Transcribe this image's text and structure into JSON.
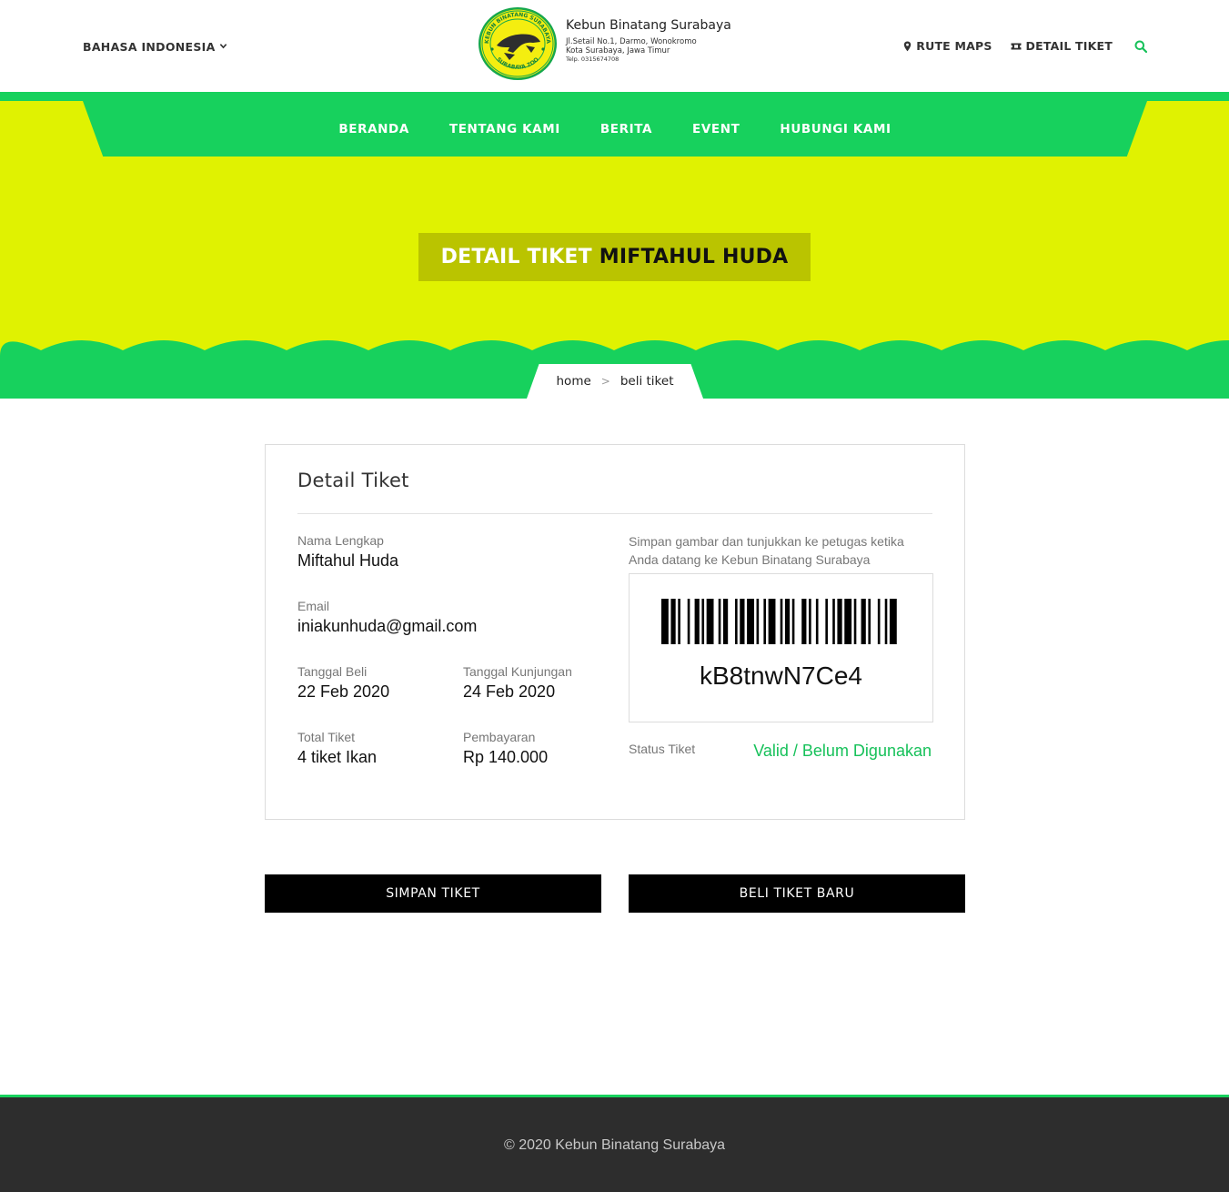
{
  "header": {
    "language": "BAHASA INDONESIA",
    "logo": {
      "ring_top_text": "KEBUN BINATANG SURABAYA",
      "ring_bottom_text": "SURABAYA ZOO",
      "title": "Kebun Binatang Surabaya",
      "address_line1": "Jl.Setail No.1, Darmo, Wonokromo",
      "address_line2": "Kota Surabaya, Jawa Timur",
      "phone": "Telp. 0315674708"
    },
    "links": [
      {
        "label": "RUTE MAPS",
        "icon": "map-pin-icon"
      },
      {
        "label": "DETAIL TIKET",
        "icon": "ticket-icon"
      }
    ],
    "search_icon": "search-icon"
  },
  "nav": {
    "items": [
      "BERANDA",
      "TENTANG KAMI",
      "BERITA",
      "EVENT",
      "HUBUNGI KAMI"
    ]
  },
  "hero": {
    "title_prefix": "DETAIL TIKET",
    "title_name": "MIFTAHUL HUDA",
    "breadcrumb": {
      "home": "home",
      "separator": ">",
      "current": "beli tiket"
    }
  },
  "ticket": {
    "card_title": "Detail Tiket",
    "name_label": "Nama Lengkap",
    "name_value": "Miftahul Huda",
    "email_label": "Email",
    "email_value": "iniakunhuda@gmail.com",
    "purchase_date_label": "Tanggal Beli",
    "purchase_date_value": "22 Feb 2020",
    "visit_date_label": "Tanggal Kunjungan",
    "visit_date_value": "24 Feb 2020",
    "total_label": "Total Tiket",
    "total_value": "4 tiket Ikan",
    "payment_label": "Pembayaran",
    "payment_value": "Rp 140.000",
    "note": "Simpan gambar dan tunjukkan ke petugas ketika Anda datang ke Kebun Binatang Surabaya",
    "code": "kB8tnwN7Ce4",
    "status_label": "Status Tiket",
    "status_value": "Valid / Belum Digunakan"
  },
  "buttons": {
    "save": "SIMPAN TIKET",
    "new": "BELI TIKET BARU"
  },
  "footer": {
    "copyright": "© 2020 Kebun Binatang Surabaya"
  },
  "colors": {
    "brand_green": "#17d15d",
    "hero_yellow": "#e0f201",
    "title_box": "#bac400",
    "status_green": "#17c15a",
    "footer_bg": "#2d2d2d"
  }
}
